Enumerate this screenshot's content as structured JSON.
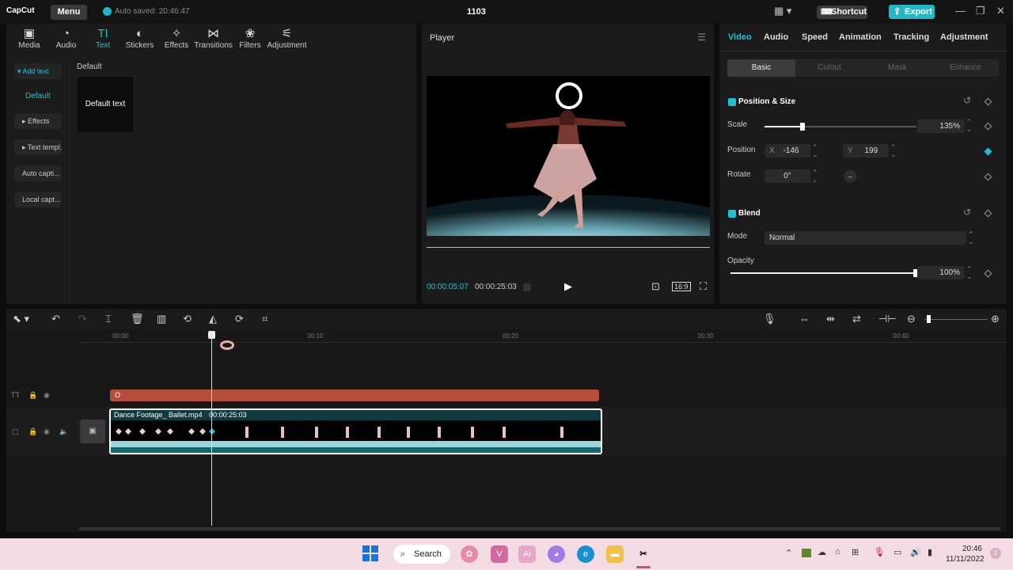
{
  "titlebar": {
    "logo": "CapCut",
    "menu_label": "Menu",
    "autosave": "Auto saved: 20:46:47",
    "project_title": "1103",
    "shortcut_label": "Shortcut",
    "export_label": "Export"
  },
  "left_toolbar": [
    {
      "label": "Media",
      "icon": "media-icon"
    },
    {
      "label": "Audio",
      "icon": "audio-icon"
    },
    {
      "label": "Text",
      "icon": "text-icon",
      "active": true
    },
    {
      "label": "Stickers",
      "icon": "stickers-icon"
    },
    {
      "label": "Effects",
      "icon": "effects-icon"
    },
    {
      "label": "Transitions",
      "icon": "transitions-icon"
    },
    {
      "label": "Filters",
      "icon": "filters-icon"
    },
    {
      "label": "Adjustment",
      "icon": "adjustment-icon"
    }
  ],
  "text_sidebar": {
    "add_text": "Add text",
    "default_link": "Default",
    "effects": "Effects",
    "templates": "Text templ...",
    "auto_captions": "Auto capti...",
    "local_captions": "Local capt..."
  },
  "text_content": {
    "section_title": "Default",
    "tile_label": "Default text"
  },
  "player": {
    "title": "Player",
    "current_time": "00:00:05:07",
    "total_time": "00:00:25:03",
    "ratio_label": "16:9",
    "overlay_text": "O"
  },
  "right_tabs": [
    "Video",
    "Audio",
    "Speed",
    "Animation",
    "Tracking",
    "Adjustment"
  ],
  "sub_tabs": [
    "Basic",
    "Cutout",
    "Mask",
    "Enhance"
  ],
  "position_size": {
    "title": "Position & Size",
    "scale_label": "Scale",
    "scale_value": "135%",
    "scale_fraction": 0.25,
    "position_label": "Position",
    "x_label": "X",
    "x_value": "-146",
    "y_label": "Y",
    "y_value": "199",
    "rotate_label": "Rotate",
    "rotate_value": "0°"
  },
  "blend": {
    "title": "Blend",
    "mode_label": "Mode",
    "mode_value": "Normal",
    "opacity_label": "Opacity",
    "opacity_value": "100%",
    "opacity_fraction": 1.0
  },
  "timeline": {
    "ruler": [
      "00:00",
      "00:10",
      "00:20",
      "00:30",
      "00:40"
    ],
    "text_clip_label": "O",
    "video_clip_name": "Dance Footage_ Ballet.mp4",
    "video_clip_duration": "00:00:25:03"
  },
  "taskbar": {
    "search_label": "Search",
    "time": "20:46",
    "date": "11/11/2022",
    "notification_count": "2"
  },
  "colors": {
    "accent": "#1fc0d2",
    "text_clip": "#b54f3b",
    "video_clip": "#0d3a3e"
  }
}
